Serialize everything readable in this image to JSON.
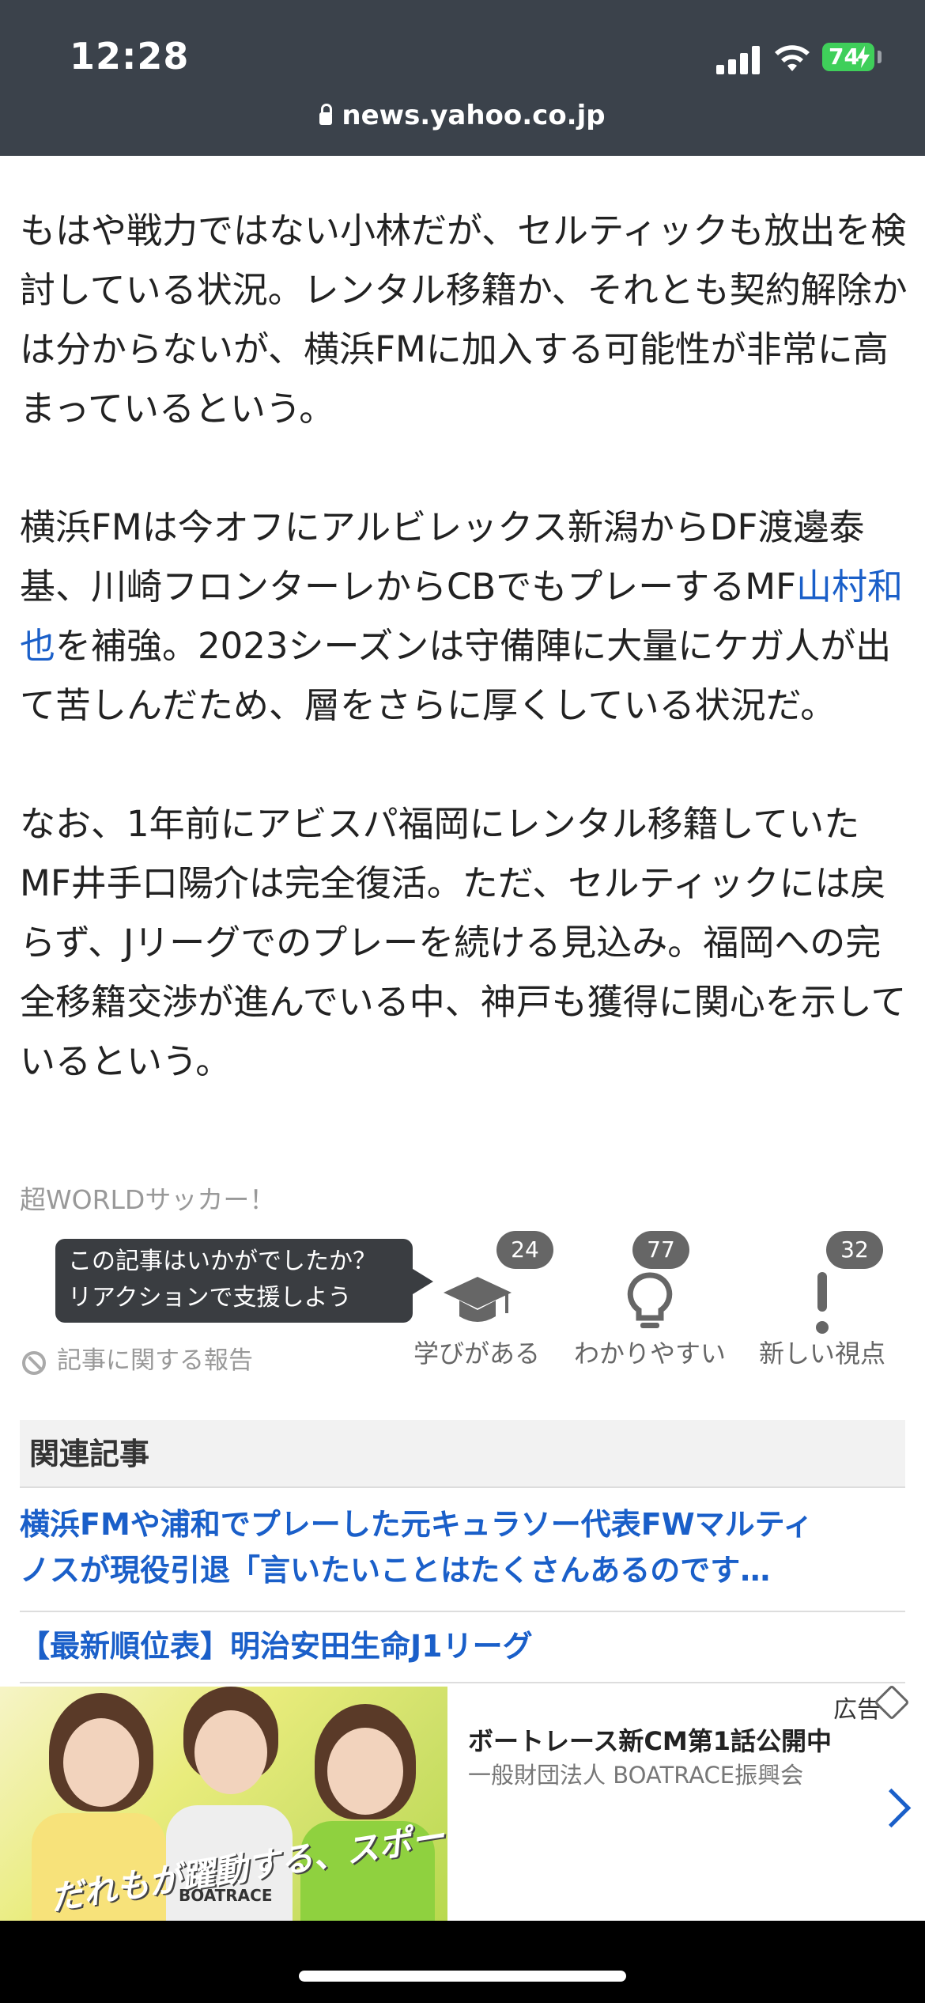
{
  "status_bar": {
    "time": "12:28",
    "battery": "74"
  },
  "browser": {
    "url": "news.yahoo.co.jp"
  },
  "article": {
    "p1": "もはや戦力ではない小林だが、セルティックも放出を検討している状況。レンタル移籍か、それとも契約解除かは分からないが、横浜FMに加入する可能性が非常に高まっているという。",
    "p2_before": "横浜FMは今オフにアルビレックス新潟からDF渡邊泰基、川崎フロンターレからCBでもプレーするMF",
    "p2_link": "山村和也",
    "p2_after": "を補強。2023シーズンは守備陣に大量にケガ人が出て苦しんだため、層をさらに厚くしている状況だ。",
    "p3": "なお、1年前にアビスパ福岡にレンタル移籍していたMF井手口陽介は完全復活。ただ、セルティックには戻らず、Jリーグでのプレーを続ける見込み。福岡への完全移籍交渉が進んでいる中、神戸も獲得に関心を示しているという。",
    "source": "超WORLDサッカー！"
  },
  "reactions": {
    "tooltip_line1": "この記事はいかがでしたか？",
    "tooltip_line2": "リアクションで支援しよう",
    "items": [
      {
        "label": "学びがある",
        "count": "24",
        "icon": "graduation-cap-icon"
      },
      {
        "label": "わかりやすい",
        "count": "77",
        "icon": "lightbulb-icon"
      },
      {
        "label": "新しい視点",
        "count": "32",
        "icon": "exclamation-icon"
      }
    ],
    "report": "記事に関する報告"
  },
  "related": {
    "heading": "関連記事",
    "items": [
      {
        "line1": "横浜FMや浦和でプレーした元キュラソー代表FWマルティ",
        "line2": "ノスが現役引退「言いたいことはたくさんあるのです…"
      },
      {
        "line1": "【最新順位表】明治安田生命J1リーグ"
      }
    ]
  },
  "ad": {
    "label": "広告",
    "title": "ボートレース新CM第1話公開中",
    "sponsor": "一般財団法人 BOATRACE振興会",
    "slogan": "だれもが躍動する、スポーツ",
    "brand": "BOATRACE"
  },
  "colors": {
    "link": "#1a5fc9",
    "topbar": "#3b424b",
    "battery": "#3fcf5a"
  }
}
